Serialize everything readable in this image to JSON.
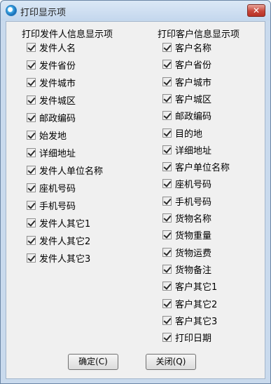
{
  "window": {
    "title": "打印显示项",
    "close_label": "✕"
  },
  "sender_group": {
    "header": "打印发件人信息显示项",
    "items": [
      {
        "label": "发件人名",
        "checked": true
      },
      {
        "label": "发件省份",
        "checked": true
      },
      {
        "label": "发件城市",
        "checked": true
      },
      {
        "label": "发件城区",
        "checked": true
      },
      {
        "label": "邮政编码",
        "checked": true
      },
      {
        "label": "始发地",
        "checked": true
      },
      {
        "label": "详细地址",
        "checked": true
      },
      {
        "label": "发件人单位名称",
        "checked": true
      },
      {
        "label": "座机号码",
        "checked": true
      },
      {
        "label": "手机号码",
        "checked": true
      },
      {
        "label": "发件人其它1",
        "checked": true
      },
      {
        "label": "发件人其它2",
        "checked": true
      },
      {
        "label": "发件人其它3",
        "checked": true
      }
    ]
  },
  "customer_group": {
    "header": "打印客户信息显示项",
    "items": [
      {
        "label": "客户名称",
        "checked": true
      },
      {
        "label": "客户省份",
        "checked": true
      },
      {
        "label": "客户城市",
        "checked": true
      },
      {
        "label": "客户城区",
        "checked": true
      },
      {
        "label": "邮政编码",
        "checked": true
      },
      {
        "label": "目的地",
        "checked": true
      },
      {
        "label": "详细地址",
        "checked": true
      },
      {
        "label": "客户单位名称",
        "checked": true
      },
      {
        "label": "座机号码",
        "checked": true
      },
      {
        "label": "手机号码",
        "checked": true
      },
      {
        "label": "货物名称",
        "checked": true
      },
      {
        "label": "货物重量",
        "checked": true
      },
      {
        "label": "货物运费",
        "checked": true
      },
      {
        "label": "货物备注",
        "checked": true
      },
      {
        "label": "客户其它1",
        "checked": true
      },
      {
        "label": "客户其它2",
        "checked": true
      },
      {
        "label": "客户其它3",
        "checked": true
      },
      {
        "label": "打印日期",
        "checked": true
      }
    ]
  },
  "buttons": {
    "ok_label": "确定(C)",
    "close_label": "关闭(Q)"
  }
}
